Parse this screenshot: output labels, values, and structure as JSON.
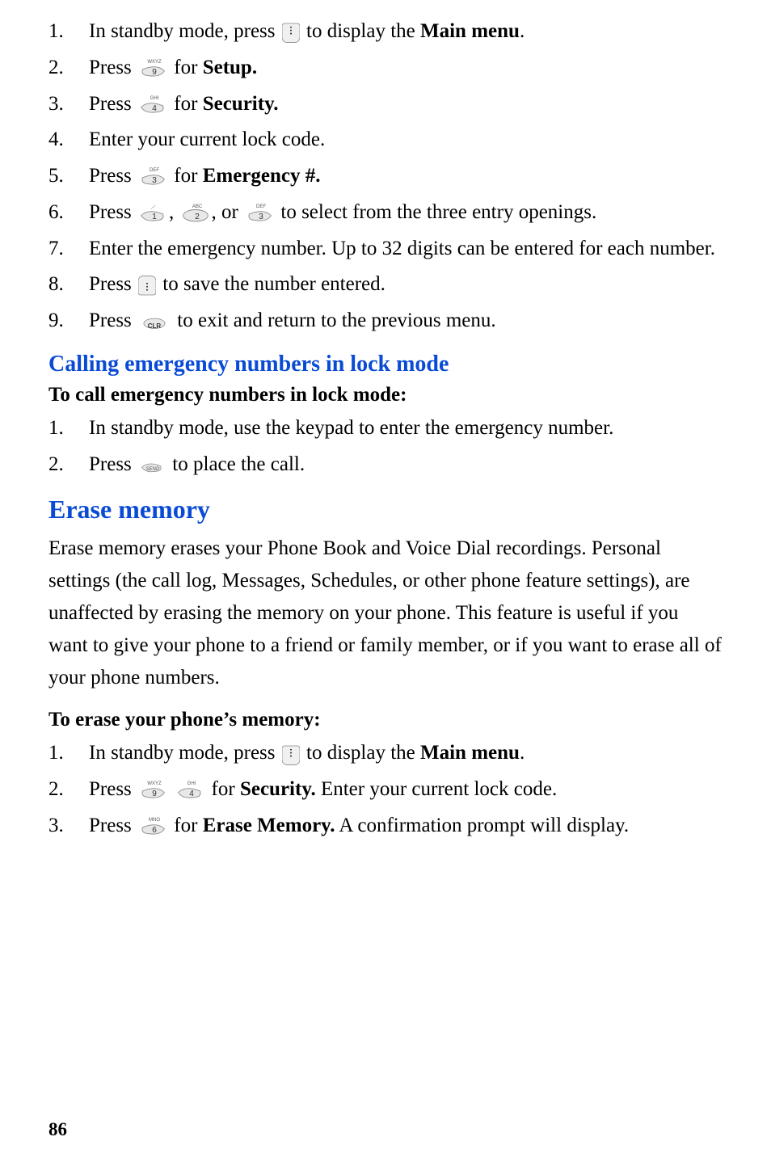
{
  "sectionA": {
    "steps": {
      "1": {
        "t1": "In standby mode, press",
        "t2": " to display the ",
        "bold": "Main menu",
        "t3": "."
      },
      "2": {
        "t1": "Press ",
        "t2": " for ",
        "bold": "Setup."
      },
      "3": {
        "t1": "Press ",
        "t2": " for ",
        "bold": "Security."
      },
      "4": {
        "t1": "Enter your current lock code."
      },
      "5": {
        "t1": "Press ",
        "t2": " for ",
        "bold": "Emergency #."
      },
      "6": {
        "t1": "Press ",
        "t2": ", ",
        "t3": ", or ",
        "t4": " to select from the three entry openings."
      },
      "7": {
        "t1": "Enter the emergency number. Up to 32 digits can be entered for each number."
      },
      "8": {
        "t1": "Press ",
        "t2": " to save the number entered."
      },
      "9": {
        "t1": "Press ",
        "t2": " to exit and return to the previous menu."
      }
    }
  },
  "sectionB": {
    "heading": "Calling emergency numbers in lock mode",
    "subheading": "To call emergency numbers in lock mode:",
    "steps": {
      "1": {
        "t1": "In standby mode, use the keypad to enter the emergency number."
      },
      "2": {
        "t1": "Press ",
        "t2": " to place the call."
      }
    }
  },
  "sectionC": {
    "heading": "Erase memory",
    "para": "Erase memory erases your Phone Book and Voice Dial recordings. Personal settings (the call log, Messages, Schedules, or other phone feature settings), are unaffected by erasing the memory on your phone. This feature is useful if you want to give your phone to a friend or family member, or if you want to erase all of your phone numbers.",
    "subheading": "To erase your phone’s memory:",
    "steps": {
      "1": {
        "t1": "In standby mode, press",
        "t2": " to display the ",
        "bold": "Main menu",
        "t3": "."
      },
      "2": {
        "t1": "Press ",
        "t2": " for ",
        "bold": "Security.",
        "t3": " Enter your current lock code."
      },
      "3": {
        "t1": "Press ",
        "t2": " for ",
        "bold": "Erase Memory.",
        "t3": " A confirmation prompt will display."
      }
    }
  },
  "pageNumber": "86"
}
